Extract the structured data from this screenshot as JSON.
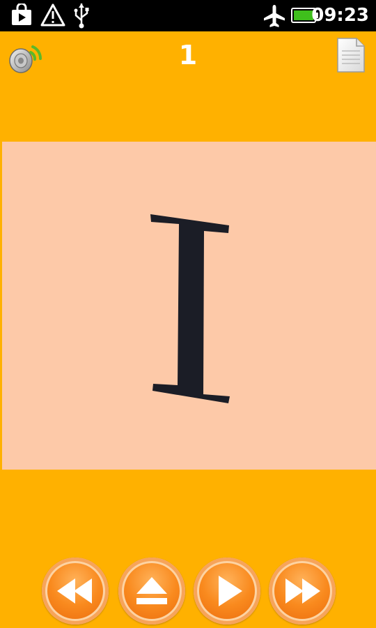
{
  "status_bar": {
    "time": "09:23",
    "icons": [
      "bag-icon",
      "warning-icon",
      "usb-icon",
      "airplane-icon",
      "battery-icon"
    ]
  },
  "header": {
    "page_number": "1",
    "speaker_icon": "speaker-icon",
    "document_icon": "document-icon"
  },
  "card": {
    "letter": "I",
    "background": "#FDC9A8",
    "letter_color": "#1B1D26"
  },
  "controls": {
    "buttons": [
      "rewind",
      "eject",
      "play",
      "fast-forward"
    ]
  },
  "colors": {
    "background": "#FFB100",
    "button_orange": "#F98A1E",
    "status_bar": "#000000"
  }
}
